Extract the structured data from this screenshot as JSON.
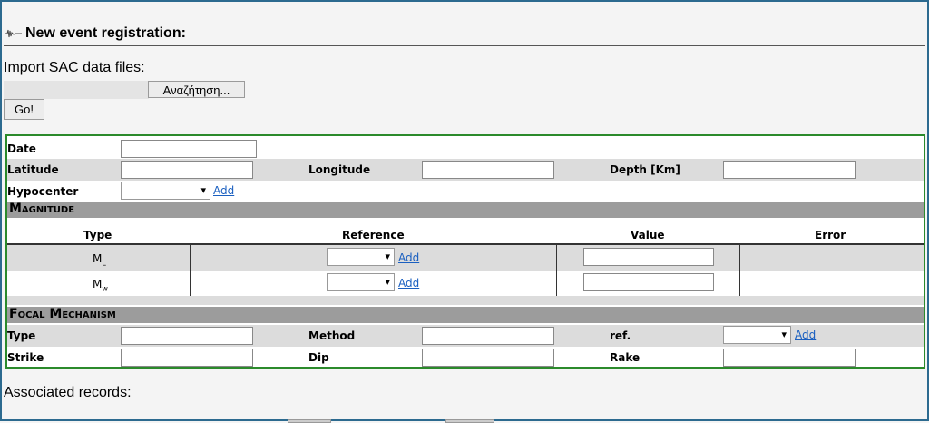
{
  "header": {
    "title": "New event registration:",
    "icon": "seismogram-icon"
  },
  "import": {
    "label": "Import SAC data files:",
    "browse_label": "Αναζήτηση...",
    "go_label": "Go!"
  },
  "event": {
    "date_label": "Date",
    "latitude_label": "Latitude",
    "longitude_label": "Longitude",
    "depth_label": "Depth [Km]",
    "hypocenter_label": "Hypocenter",
    "add_label": "Add"
  },
  "magnitude": {
    "title": "Magnitude",
    "columns": [
      "Type",
      "Reference",
      "Value",
      "Error"
    ],
    "rows": [
      {
        "type_main": "M",
        "type_sub": "L",
        "add_label": "Add"
      },
      {
        "type_main": "M",
        "type_sub": "w",
        "add_label": "Add"
      }
    ]
  },
  "focal": {
    "title": "Focal Mechanism",
    "type_label": "Type",
    "method_label": "Method",
    "ref_label": "ref.",
    "add_label": "Add",
    "strike_label": "Strike",
    "dip_label": "Dip",
    "rake_label": "Rake"
  },
  "footer": {
    "associated_label": "Associated records:"
  },
  "colors": {
    "section_bg": "#9c9c9c",
    "alt_row": "#dcdcdc",
    "frame_border": "#2b8a2b",
    "link": "#1a5fc0"
  }
}
